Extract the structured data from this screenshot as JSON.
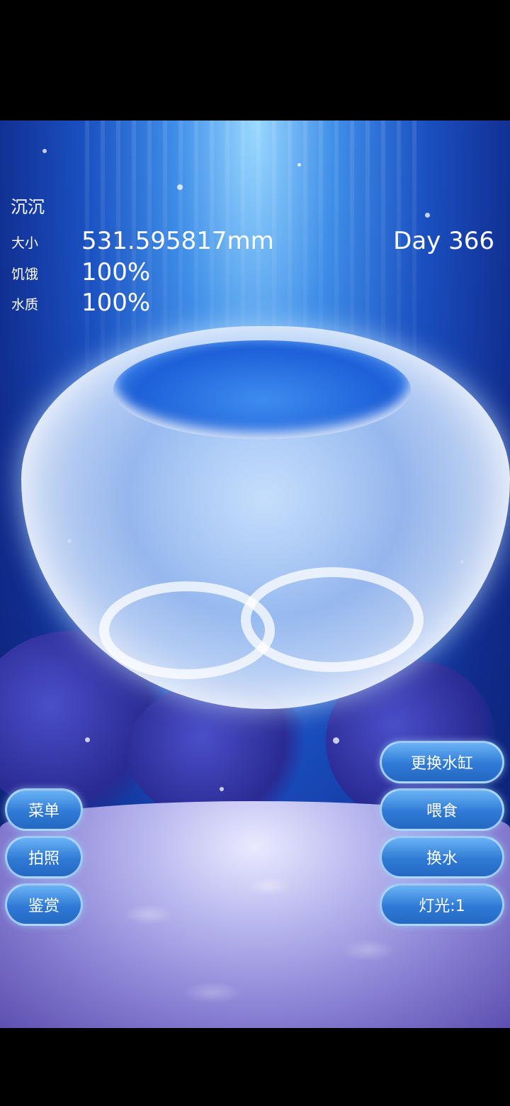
{
  "hud": {
    "name": "沉沉",
    "size_label": "大小",
    "size_value": "531.595817mm",
    "hunger_label": "饥饿",
    "hunger_value": "100%",
    "water_label": "水质",
    "water_value": "100%",
    "day": "Day 366"
  },
  "left_buttons": {
    "menu": "菜单",
    "photo": "拍照",
    "appreciate": "鉴赏"
  },
  "right_buttons": {
    "change_tank": "更换水缸",
    "feed": "喂食",
    "change_water": "换水",
    "light": "灯光:1"
  },
  "colors": {
    "water_light": "#9ad8ff",
    "water_deep": "#0b1f6a",
    "button_blue": "#2f7ad6"
  }
}
